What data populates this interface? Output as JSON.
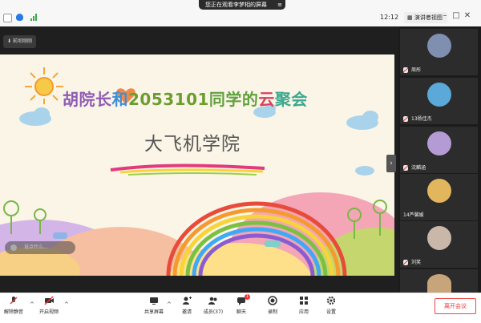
{
  "top_bar": {
    "sharing_banner": "您正在观看李梦相的屏幕",
    "clock": "12:12",
    "layout_button": "演讲者视图",
    "window_controls": [
      "minimize",
      "maximize",
      "close"
    ]
  },
  "host_label": "前坝刚刚",
  "slide": {
    "title_parts": [
      {
        "text": "胡院长",
        "color": "#8e5bb5"
      },
      {
        "text": "和",
        "color": "#3f8ed8"
      },
      {
        "text": "2053101",
        "color": "#6b9d2f"
      },
      {
        "text": "同学的",
        "color": "#5fa13c"
      },
      {
        "text": "云",
        "color": "#d8405e"
      },
      {
        "text": "聚会",
        "color": "#3aa88e"
      }
    ],
    "subtitle": "大飞机学院"
  },
  "chat_hint": "说点什么...",
  "participants": [
    {
      "name": "周彤",
      "avatar_color": "#7e8fb0"
    },
    {
      "name": "13杨佳杰",
      "avatar_color": "#5aa9d8"
    },
    {
      "name": "沈麟涵",
      "avatar_color": "#b59bd4"
    },
    {
      "name": "14芦馨媛",
      "avatar_color": "#e2b65d"
    },
    {
      "name": "刘笑",
      "avatar_color": "#c9b8a9"
    },
    {
      "name": "",
      "avatar_color": "#c8a47a"
    }
  ],
  "toolbar": {
    "unmute": "解除静音",
    "start_video": "开启视频",
    "share_screen": "共享屏幕",
    "invite": "邀请",
    "members": "成员(37)",
    "chat": "聊天",
    "record": "录制",
    "apps": "应用",
    "settings": "设置",
    "leave": "离开会议",
    "chat_badge": "1"
  }
}
